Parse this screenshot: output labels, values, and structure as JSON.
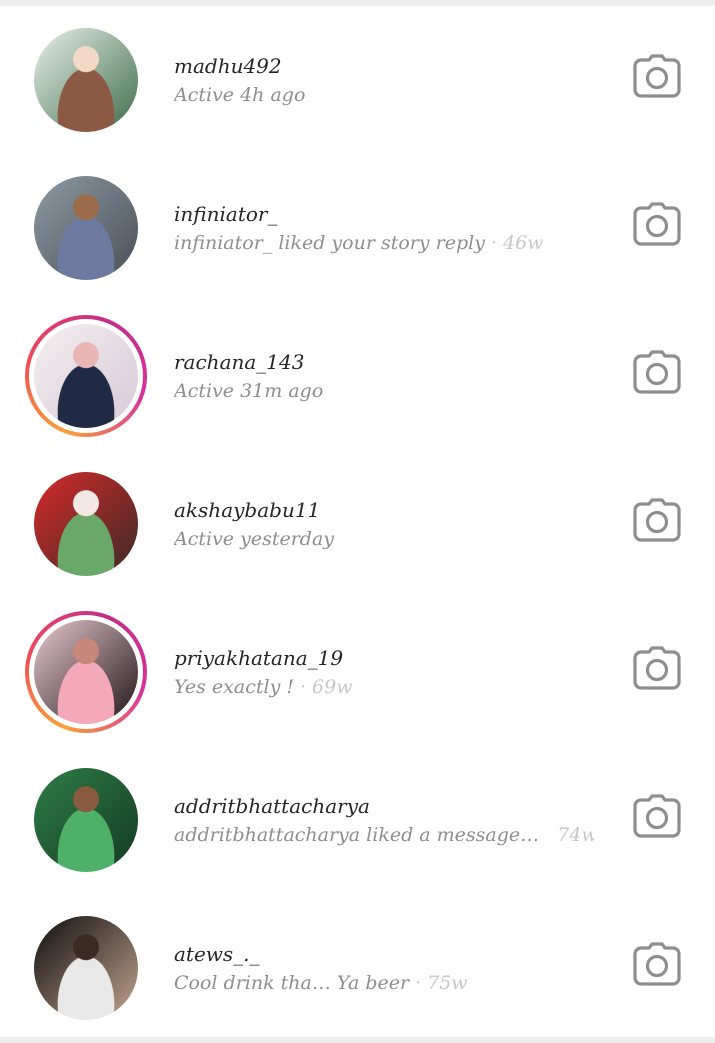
{
  "threads": [
    {
      "username": "madhu492",
      "status": "Active 4h ago",
      "time": "",
      "ring": false,
      "avatar_colors": [
        "#e9f0ea",
        "#3d6d48",
        "#f2d9c6",
        "#8c5a44"
      ]
    },
    {
      "username": "infiniator_",
      "status": "infiniator_ liked your story reply",
      "time": "46w",
      "ring": false,
      "avatar_colors": [
        "#8d9aa3",
        "#4a4f57",
        "#9b6b4c",
        "#6c7aa0"
      ]
    },
    {
      "username": "rachana_143",
      "status": "Active 31m ago",
      "time": "",
      "ring": true,
      "avatar_colors": [
        "#f4efef",
        "#d7c9d8",
        "#e9b6b4",
        "#1f2a45"
      ]
    },
    {
      "username": "akshaybabu11",
      "status": "Active yesterday",
      "time": "",
      "ring": false,
      "avatar_colors": [
        "#d62a2a",
        "#3b2a25",
        "#f2e7e2",
        "#6aa86a"
      ]
    },
    {
      "username": "priyakhatana_19",
      "status": "Yes exactly !",
      "time": "69w",
      "ring": true,
      "avatar_colors": [
        "#e7c9cf",
        "#1e1416",
        "#c9867a",
        "#f3a9b8"
      ]
    },
    {
      "username": "addritbhattacharya",
      "status": "addritbhattacharya liked a message…",
      "time": "74w",
      "ring": false,
      "avatar_colors": [
        "#2e7d45",
        "#143a22",
        "#8a5a40",
        "#4fb06a"
      ]
    },
    {
      "username": "atews_._",
      "status": "Cool drink tha… Ya beer",
      "time": "75w",
      "ring": false,
      "avatar_colors": [
        "#0e0e0e",
        "#c4a48e",
        "#3a2a22",
        "#e8e8e8"
      ]
    }
  ],
  "icons": {
    "row_action": "camera-icon"
  },
  "colors": {
    "username": "#262626",
    "status": "#8e8e8e",
    "time": "#c7c7c7",
    "icon": "#8e8e8e",
    "ring_start": "#f9a23a",
    "ring_end": "#d7339b"
  }
}
